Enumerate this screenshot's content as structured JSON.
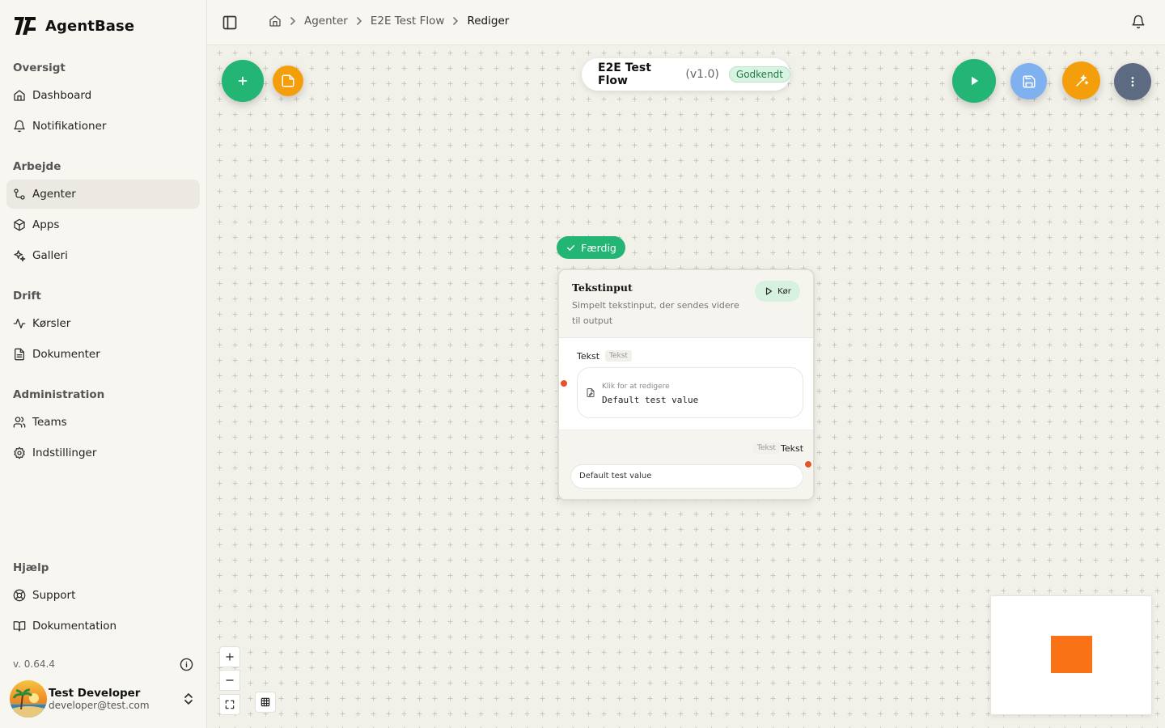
{
  "brand": {
    "name": "AgentBase"
  },
  "sidebar": {
    "groups": [
      {
        "label": "Oversigt",
        "items": [
          {
            "label": "Dashboard",
            "icon": "home-icon"
          },
          {
            "label": "Notifikationer",
            "icon": "bell-icon"
          }
        ]
      },
      {
        "label": "Arbejde",
        "items": [
          {
            "label": "Agenter",
            "icon": "workflow-icon",
            "active": true
          },
          {
            "label": "Apps",
            "icon": "package-icon"
          },
          {
            "label": "Galleri",
            "icon": "sparkles-icon"
          }
        ]
      },
      {
        "label": "Drift",
        "items": [
          {
            "label": "Kørsler",
            "icon": "activity-icon"
          },
          {
            "label": "Dokumenter",
            "icon": "file-text-icon"
          }
        ]
      },
      {
        "label": "Administration",
        "items": [
          {
            "label": "Teams",
            "icon": "users-icon"
          },
          {
            "label": "Indstillinger",
            "icon": "gear-icon"
          }
        ]
      },
      {
        "label": "Hjælp",
        "items": [
          {
            "label": "Support",
            "icon": "lifebuoy-icon"
          },
          {
            "label": "Dokumentation",
            "icon": "book-open-icon"
          }
        ]
      }
    ],
    "version": "v. 0.64.4",
    "user": {
      "name": "Test Developer",
      "email": "developer@test.com"
    }
  },
  "breadcrumb": {
    "items": [
      "Agenter",
      "E2E Test Flow"
    ],
    "current": "Rediger"
  },
  "flow": {
    "name": "E2E Test Flow",
    "version": "(v1.0)",
    "status": "Godkendt"
  },
  "node": {
    "status_badge": "Færdig",
    "title": "Tekstinput",
    "description": "Simpelt tekstinput, der sendes videre til output",
    "run_label": "Kør",
    "input_label": "Tekst",
    "input_type": "Tekst",
    "edit_hint": "Klik for at redigere",
    "input_value": "Default test value",
    "output_type": "Tekst",
    "output_label": "Tekst",
    "output_value": "Default test value"
  },
  "colors": {
    "accent_green": "#22b573",
    "accent_orange": "#f59e0b",
    "handle": "#e6532b",
    "minimap_node": "#f97316"
  }
}
